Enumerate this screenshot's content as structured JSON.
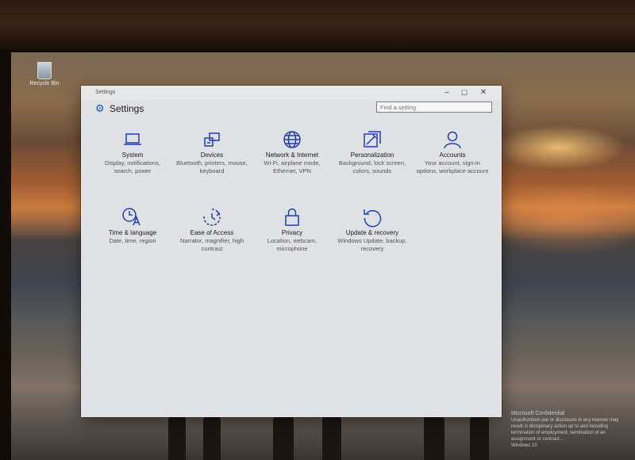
{
  "desktop": {
    "recycle_bin_label": "Recycle Bin",
    "watermark_title": "Microsoft Confidential",
    "watermark_text": "Unauthorized use or disclosure in any manner may result in disciplinary action up to and including termination of employment, termination of an assignment or contract...",
    "watermark_build": "Windows 10"
  },
  "window": {
    "titlebar_title": "Settings",
    "header_title": "Settings",
    "search_placeholder": "Find a setting",
    "controls": {
      "minimize": "–",
      "maximize": "☐",
      "close": "✕"
    }
  },
  "categories": [
    {
      "label": "System",
      "desc": "Display, notifications, search, power",
      "icon": "laptop-icon"
    },
    {
      "label": "Devices",
      "desc": "Bluetooth, printers, mouse, keyboard",
      "icon": "devices-icon"
    },
    {
      "label": "Network & Internet",
      "desc": "Wi-Fi, airplane mode, Ethernet, VPN",
      "icon": "globe-icon"
    },
    {
      "label": "Personalization",
      "desc": "Background, lock screen, colors, sounds",
      "icon": "personalization-icon"
    },
    {
      "label": "Accounts",
      "desc": "Your account, sign-in options, workplace account",
      "icon": "person-icon"
    },
    {
      "label": "Time & language",
      "desc": "Date, time, region",
      "icon": "time-language-icon"
    },
    {
      "label": "Ease of Access",
      "desc": "Narrator, magnifier, high contrast",
      "icon": "ease-of-access-icon"
    },
    {
      "label": "Privacy",
      "desc": "Location, webcam, microphone",
      "icon": "lock-icon"
    },
    {
      "label": "Update & recovery",
      "desc": "Windows Update, backup, recovery",
      "icon": "refresh-icon"
    }
  ],
  "colors": {
    "accent": "#1f3fb8",
    "window_bg": "#dfe1e4"
  }
}
